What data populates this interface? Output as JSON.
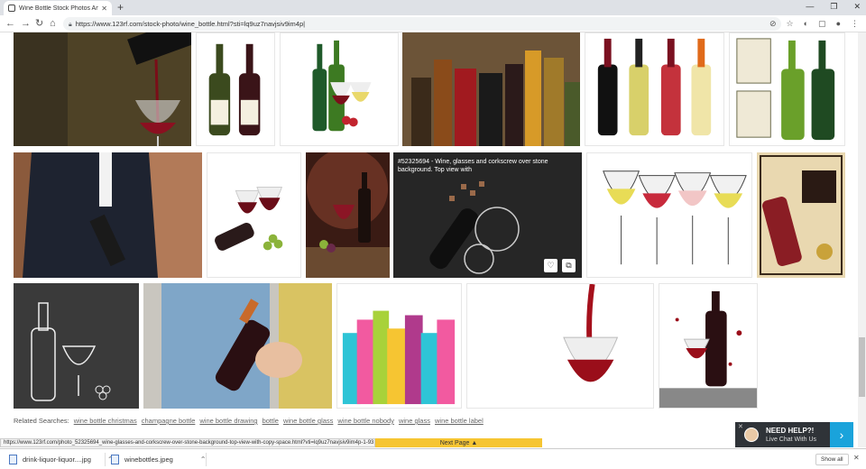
{
  "browser": {
    "tab_title": "Wine Bottle Stock Photos And Im",
    "new_tab": "+",
    "url": "https://www.123rf.com/stock-photo/wine_bottle.html?sti=lq9uz7navjsiv9im4p|"
  },
  "gallery": {
    "overlay_caption": "#52325694 - Wine, glasses and corkscrew over stone background. Top view with",
    "like_icon": "heart-icon",
    "collection_icon": "lightbox-icon"
  },
  "related": {
    "label": "Related Searches:",
    "tags": [
      "wine bottle christmas",
      "champagne bottle",
      "wine bottle drawing",
      "bottle",
      "wine bottle glass",
      "wine bottle nobody",
      "wine glass",
      "wine bottle label"
    ]
  },
  "status_url": "https://www.123rf.com/photo_52325694_wine-glasses-and-corkscrew-over-stone-background-top-view-with-copy-space.html?vti=lq9uz7navjsiv9im4p-1-93",
  "next_page": "Next Page",
  "chat": {
    "title": "NEED HELP?!",
    "subtitle": "Live Chat With Us"
  },
  "downloads": {
    "items": [
      "drink-liquor-liquor....jpg",
      "winebottles.jpeg"
    ],
    "show_all": "Show all"
  },
  "colors": {
    "next_page_bg": "#f6c532",
    "chat_accent": "#1aa3db"
  }
}
